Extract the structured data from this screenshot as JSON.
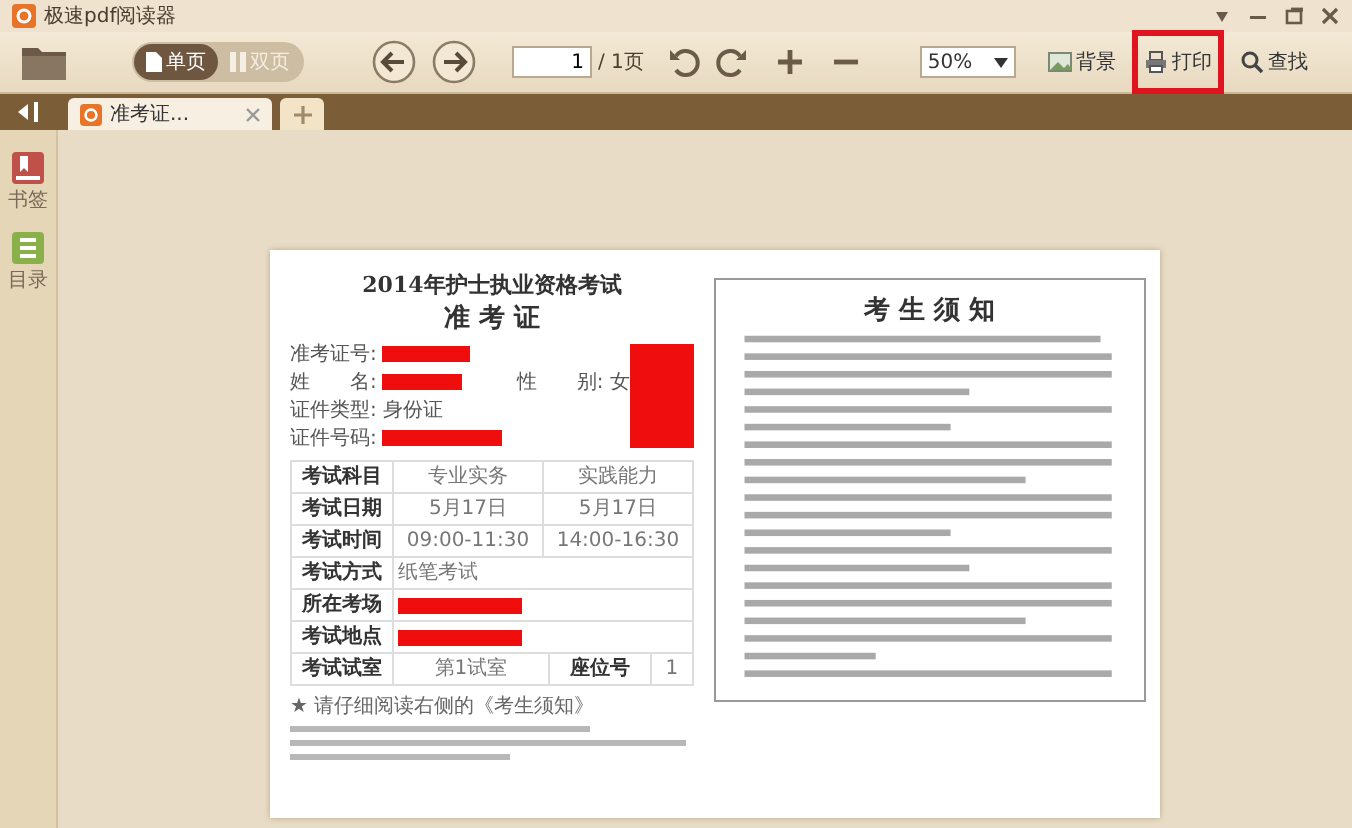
{
  "window": {
    "title": "极速pdf阅读器"
  },
  "toolbar": {
    "view_modes": [
      {
        "label": "单页",
        "selected": true
      },
      {
        "label": "双页",
        "selected": false
      }
    ],
    "page_input": {
      "value": "1"
    },
    "page_total": "/ 1页",
    "zoom": "50%",
    "buttons": [
      {
        "kind": "background",
        "label": "背景",
        "highlighted": false
      },
      {
        "kind": "print",
        "label": "打印",
        "highlighted": true
      },
      {
        "kind": "find",
        "label": "查找",
        "highlighted": false
      }
    ]
  },
  "tabs": [
    {
      "label": "准考证...",
      "selected": true
    }
  ],
  "sidebar": {
    "items": [
      {
        "kind": "bookmark",
        "label": "书签"
      },
      {
        "kind": "outline",
        "label": "目录"
      }
    ]
  },
  "document": {
    "title": "2014年护士执业资格考试",
    "subtitle": "准 考 证",
    "fields": [
      {
        "label": "准考证号:",
        "redacted": true
      },
      {
        "label": "姓　　名:",
        "redacted": true,
        "extra": "性　　别: 女"
      },
      {
        "label": "证件类型:",
        "value": "身份证",
        "redacted": false
      },
      {
        "label": "证件号码:",
        "redacted": true
      }
    ],
    "table": {
      "rows": [
        [
          {
            "kind": "header",
            "text": "考试科目"
          },
          {
            "kind": "value",
            "text": "专业实务"
          },
          {
            "kind": "value",
            "text": "实践能力"
          }
        ],
        [
          {
            "kind": "header",
            "text": "考试日期"
          },
          {
            "kind": "value",
            "text": "5月17日"
          },
          {
            "kind": "value",
            "text": "5月17日"
          }
        ],
        [
          {
            "kind": "header",
            "text": "考试时间"
          },
          {
            "kind": "value",
            "text": "09:00-11:30"
          },
          {
            "kind": "value",
            "text": "14:00-16:30"
          }
        ],
        [
          {
            "kind": "header",
            "text": "考试方式"
          },
          {
            "kind": "wide",
            "text": "纸笔考试"
          }
        ],
        [
          {
            "kind": "header",
            "text": "所在考场"
          },
          {
            "kind": "redacted"
          }
        ],
        [
          {
            "kind": "header",
            "text": "考试地点"
          },
          {
            "kind": "redacted"
          }
        ],
        [
          {
            "kind": "header",
            "text": "考试试室"
          },
          {
            "kind": "value",
            "text": "第1试室"
          },
          {
            "kind": "header",
            "text": "座位号"
          },
          {
            "kind": "value",
            "text": "1"
          }
        ]
      ]
    },
    "note": "★ 请仔细阅读右侧的《考生须知》",
    "rules": {
      "heading": "考 生 须 知"
    }
  }
}
